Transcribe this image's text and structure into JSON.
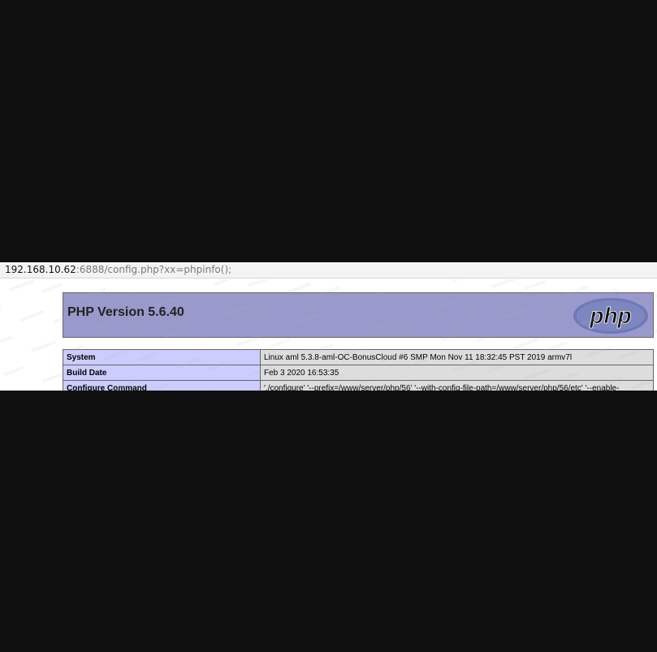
{
  "browser": {
    "url_host": "192.168.10.62",
    "url_rest": ":6888/config.php?xx=phpinfo();"
  },
  "phpinfo": {
    "title": "PHP Version 5.6.40",
    "logo_text": "php",
    "rows": [
      {
        "key": "System",
        "value": "Linux aml 5.3.8-aml-OC-BonusCloud #6 SMP Mon Nov 11 18:32:45 PST 2019 armv7l"
      },
      {
        "key": "Build Date",
        "value": "Feb 3 2020 16:53:35"
      },
      {
        "key": "Configure Command",
        "value": "'./configure' '--prefix=/www/server/php/56' '--with-config-file-path=/www/server/php/56/etc' '--enable-"
      }
    ]
  },
  "colors": {
    "header_bg": "#9999cc",
    "key_cell_bg": "#ccccff",
    "value_cell_bg": "#dddddd",
    "outer_bg": "#0f0f0f"
  }
}
